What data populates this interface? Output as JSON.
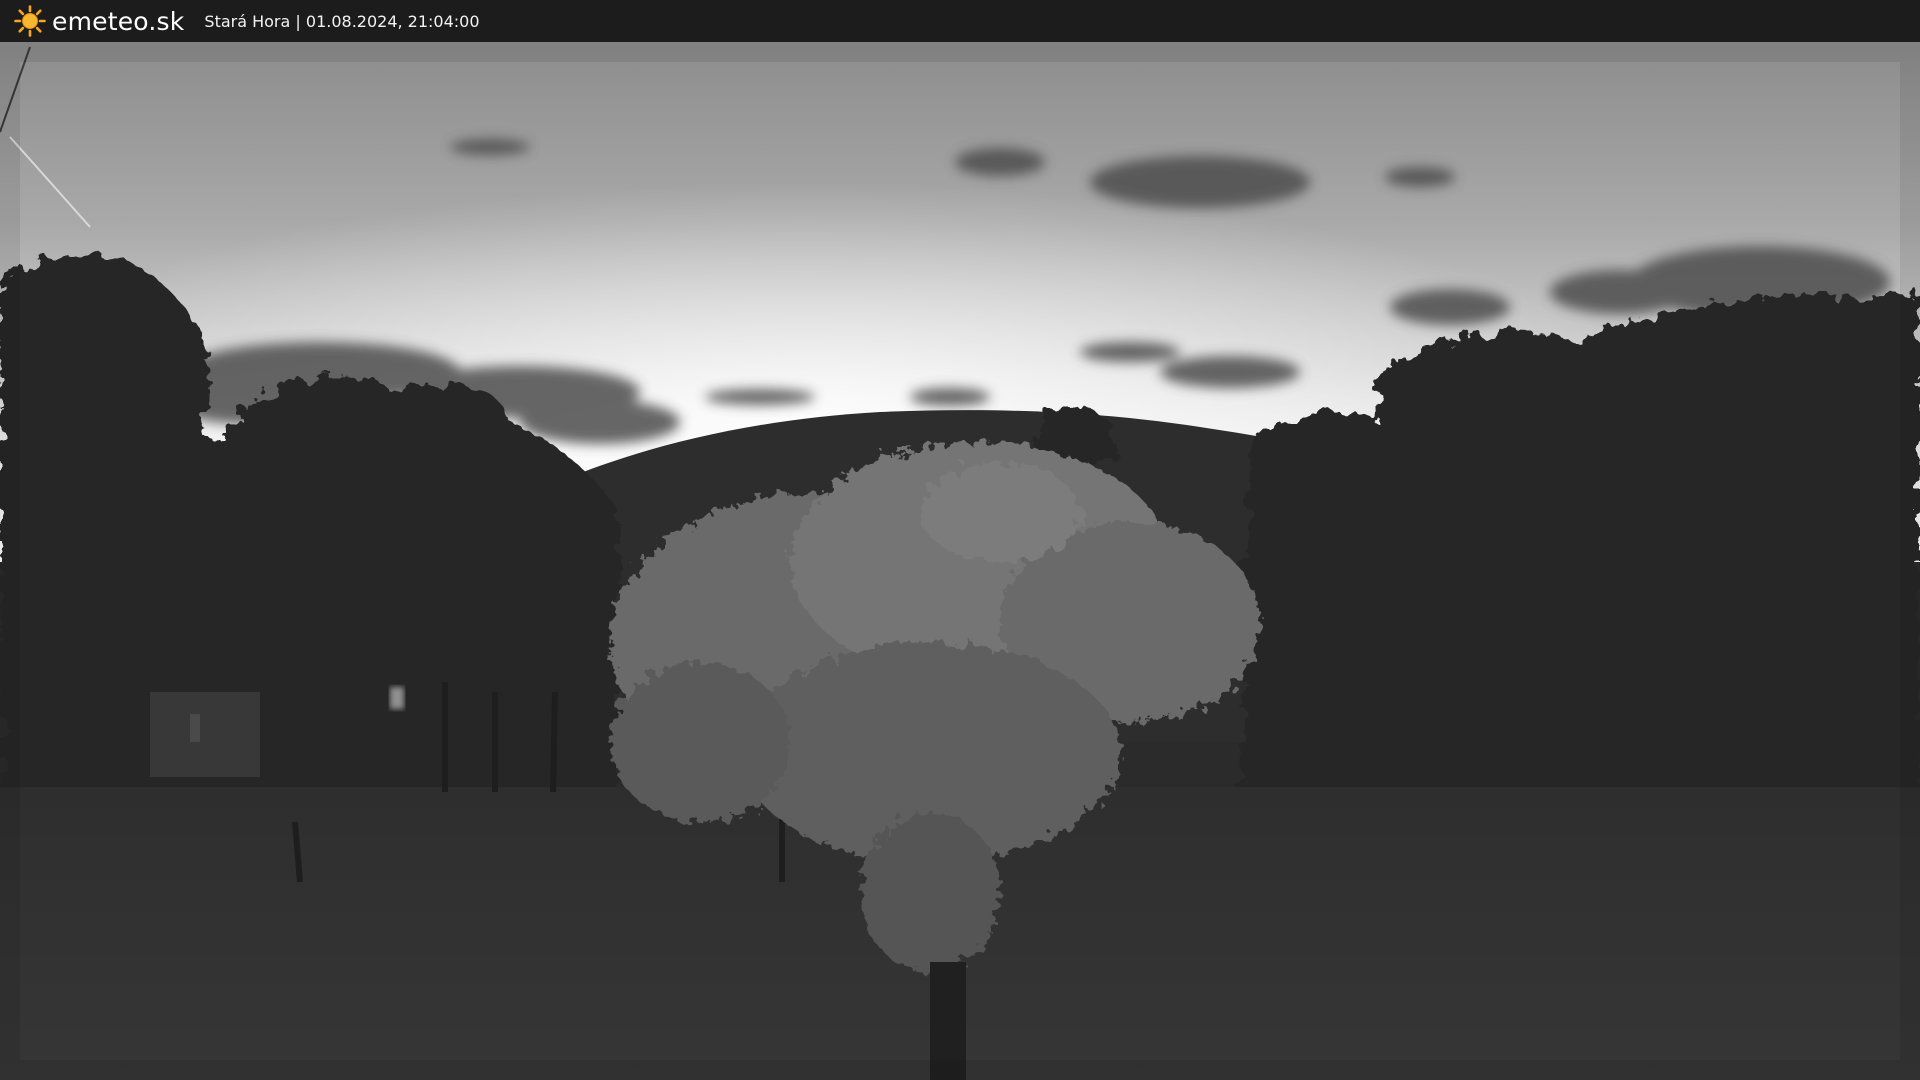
{
  "header": {
    "brand": "emeteo.sk",
    "location": "Stará Hora",
    "separator": "|",
    "timestamp": "01.08.2024, 21:04:00",
    "logo_icon": "sun-icon",
    "brand_color": "#f5a623"
  },
  "scene": {
    "colormap": "grayscale"
  }
}
